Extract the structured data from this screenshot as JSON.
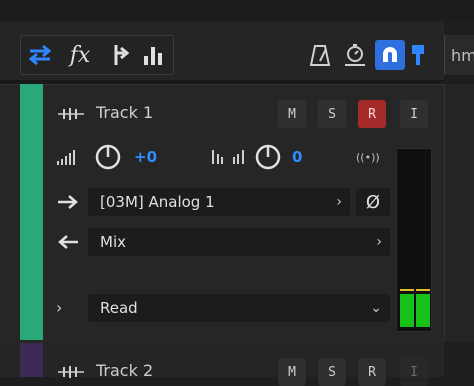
{
  "toolbar": {
    "left_icons": [
      "swap-arrows-icon",
      "fx-icon",
      "send-icon",
      "bar-chart-icon"
    ],
    "fx_label": "fx",
    "right_icons": [
      "metronome-icon",
      "timer-icon",
      "magnet-icon",
      "pin-icon"
    ]
  },
  "timeline": {
    "tab_label": "hm"
  },
  "track1": {
    "name": "Track 1",
    "buttons": {
      "mute": "M",
      "solo": "S",
      "record": "R",
      "input": "I"
    },
    "volume": {
      "value": "+0"
    },
    "pan": {
      "value": "0"
    },
    "wireless_label": "((•))",
    "input": {
      "value": "[03M] Analog 1"
    },
    "phase_symbol": "Ø",
    "output": {
      "value": "Mix"
    },
    "automation": {
      "value": "Read"
    },
    "meter": {
      "left_level": 0.19,
      "right_level": 0.19
    },
    "colors": {
      "strip": "#2aa87a",
      "record_active": "#a52a2a",
      "value_blue": "#2e8dff"
    }
  },
  "track2": {
    "name": "Track 2",
    "buttons": {
      "mute": "M",
      "solo": "S",
      "record": "R",
      "input": "I"
    }
  }
}
